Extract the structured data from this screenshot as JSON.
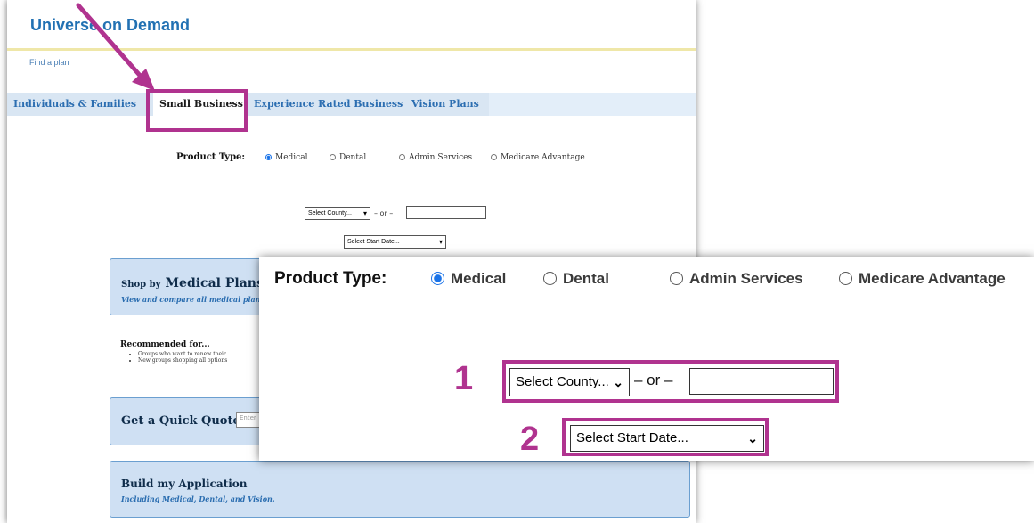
{
  "header": {
    "brand": "Universe on Demand",
    "breadcrumb": "Find a plan"
  },
  "tabs": [
    {
      "label": "Individuals & Families"
    },
    {
      "label": "Small Business"
    },
    {
      "label": "Experience Rated Business"
    },
    {
      "label": "Vision Plans"
    }
  ],
  "product_type": {
    "label": "Product Type:",
    "options": [
      {
        "label": "Medical",
        "selected": true
      },
      {
        "label": "Dental",
        "selected": false
      },
      {
        "label": "Admin Services",
        "selected": false
      },
      {
        "label": "Medicare Advantage",
        "selected": false
      }
    ]
  },
  "location": {
    "county_select": "Select County...",
    "or_text": "– or –",
    "zip_value": ""
  },
  "start_date": {
    "select": "Select Start Date..."
  },
  "cards": {
    "shop": {
      "title_prefix": "Shop by",
      "title_main": "Medical Plans",
      "subtitle": "View and compare all medical plans"
    },
    "recommended": {
      "title": "Recommended for...",
      "items": [
        "Groups who want to renew their",
        "New groups shopping all options"
      ]
    },
    "quote": {
      "title": "Get a Quick Quote",
      "placeholder": "Enter"
    },
    "build": {
      "title": "Build my Application",
      "subtitle": "Including Medical, Dental, and Vision."
    }
  },
  "callouts": {
    "step1": "1",
    "step2": "2"
  },
  "colors": {
    "highlight": "#b0338f",
    "brand": "#2271b3",
    "card_bg": "#cfe0f3",
    "radio_selected": "#1a73e8"
  }
}
